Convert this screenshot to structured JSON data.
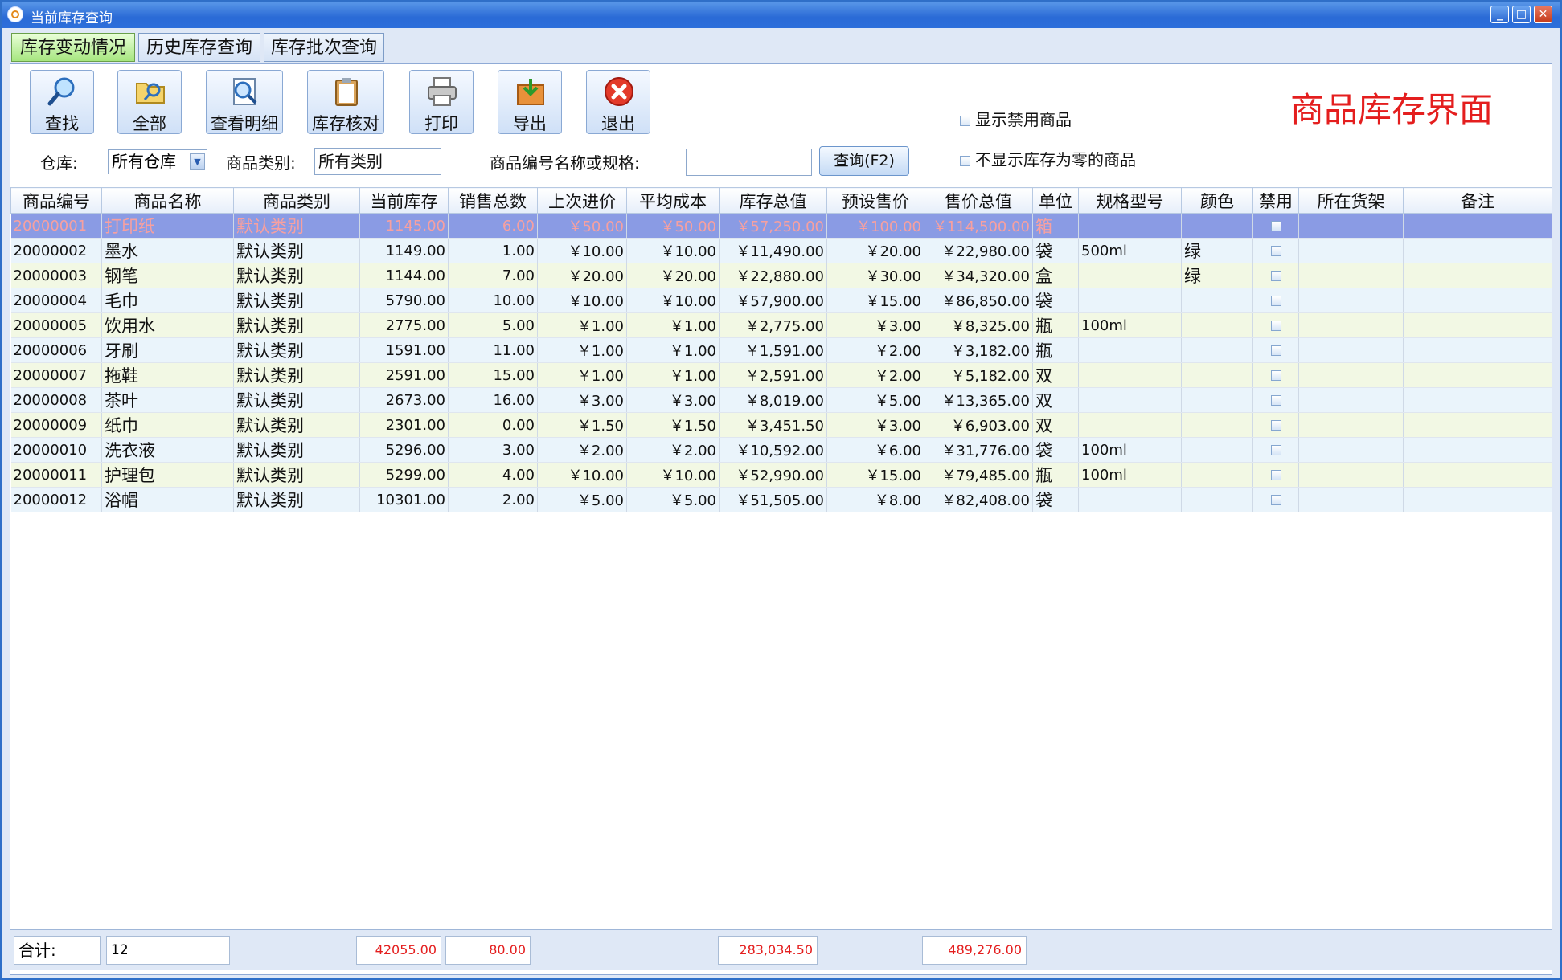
{
  "window": {
    "title": "当前库存查询",
    "min_glyph": "_",
    "max_glyph": "□",
    "close_glyph": "✕"
  },
  "tabs": [
    {
      "label": "库存变动情况",
      "active": true
    },
    {
      "label": "历史库存查询",
      "active": false
    },
    {
      "label": "库存批次查询",
      "active": false
    }
  ],
  "toolbar": {
    "buttons": [
      {
        "label": "查找",
        "icon": "magnifier-icon"
      },
      {
        "label": "全部",
        "icon": "folder-icon"
      },
      {
        "label": "查看明细",
        "icon": "document-search-icon"
      },
      {
        "label": "库存核对",
        "icon": "clipboard-icon"
      },
      {
        "label": "打印",
        "icon": "printer-icon"
      },
      {
        "label": "导出",
        "icon": "export-icon"
      },
      {
        "label": "退出",
        "icon": "close-icon"
      }
    ]
  },
  "options": {
    "show_disabled": "显示禁用商品",
    "hide_zero_stock": "不显示库存为零的商品"
  },
  "banner": "商品库存界面",
  "filters": {
    "warehouse_label": "仓库:",
    "warehouse_value": "所有仓库",
    "category_label": "商品类别:",
    "category_value": "所有类别",
    "code_label": "商品编号名称或规格:",
    "code_value": "",
    "query_button": "查询(F2)"
  },
  "table": {
    "columns": [
      "商品编号",
      "商品名称",
      "商品类别",
      "当前库存",
      "销售总数",
      "上次进价",
      "平均成本",
      "库存总值",
      "预设售价",
      "售价总值",
      "单位",
      "规格型号",
      "颜色",
      "禁用",
      "所在货架",
      "备注"
    ],
    "rows": [
      [
        "20000001",
        "打印纸",
        "默认类别",
        "1145.00",
        "6.00",
        "￥50.00",
        "￥50.00",
        "￥57,250.00",
        "￥100.00",
        "￥114,500.00",
        "箱",
        "",
        "",
        "",
        "",
        ""
      ],
      [
        "20000002",
        "墨水",
        "默认类别",
        "1149.00",
        "1.00",
        "￥10.00",
        "￥10.00",
        "￥11,490.00",
        "￥20.00",
        "￥22,980.00",
        "袋",
        "500ml",
        "绿",
        "",
        "",
        ""
      ],
      [
        "20000003",
        "钢笔",
        "默认类别",
        "1144.00",
        "7.00",
        "￥20.00",
        "￥20.00",
        "￥22,880.00",
        "￥30.00",
        "￥34,320.00",
        "盒",
        "",
        "绿",
        "",
        "",
        ""
      ],
      [
        "20000004",
        "毛巾",
        "默认类别",
        "5790.00",
        "10.00",
        "￥10.00",
        "￥10.00",
        "￥57,900.00",
        "￥15.00",
        "￥86,850.00",
        "袋",
        "",
        "",
        "",
        "",
        ""
      ],
      [
        "20000005",
        "饮用水",
        "默认类别",
        "2775.00",
        "5.00",
        "￥1.00",
        "￥1.00",
        "￥2,775.00",
        "￥3.00",
        "￥8,325.00",
        "瓶",
        "100ml",
        "",
        "",
        "",
        ""
      ],
      [
        "20000006",
        "牙刷",
        "默认类别",
        "1591.00",
        "11.00",
        "￥1.00",
        "￥1.00",
        "￥1,591.00",
        "￥2.00",
        "￥3,182.00",
        "瓶",
        "",
        "",
        "",
        "",
        ""
      ],
      [
        "20000007",
        "拖鞋",
        "默认类别",
        "2591.00",
        "15.00",
        "￥1.00",
        "￥1.00",
        "￥2,591.00",
        "￥2.00",
        "￥5,182.00",
        "双",
        "",
        "",
        "",
        "",
        ""
      ],
      [
        "20000008",
        "茶叶",
        "默认类别",
        "2673.00",
        "16.00",
        "￥3.00",
        "￥3.00",
        "￥8,019.00",
        "￥5.00",
        "￥13,365.00",
        "双",
        "",
        "",
        "",
        "",
        ""
      ],
      [
        "20000009",
        "纸巾",
        "默认类别",
        "2301.00",
        "0.00",
        "￥1.50",
        "￥1.50",
        "￥3,451.50",
        "￥3.00",
        "￥6,903.00",
        "双",
        "",
        "",
        "",
        "",
        ""
      ],
      [
        "20000010",
        "洗衣液",
        "默认类别",
        "5296.00",
        "3.00",
        "￥2.00",
        "￥2.00",
        "￥10,592.00",
        "￥6.00",
        "￥31,776.00",
        "袋",
        "100ml",
        "",
        "",
        "",
        ""
      ],
      [
        "20000011",
        "护理包",
        "默认类别",
        "5299.00",
        "4.00",
        "￥10.00",
        "￥10.00",
        "￥52,990.00",
        "￥15.00",
        "￥79,485.00",
        "瓶",
        "100ml",
        "",
        "",
        "",
        ""
      ],
      [
        "20000012",
        "浴帽",
        "默认类别",
        "10301.00",
        "2.00",
        "￥5.00",
        "￥5.00",
        "￥51,505.00",
        "￥8.00",
        "￥82,408.00",
        "袋",
        "",
        "",
        "",
        "",
        ""
      ]
    ]
  },
  "footer": {
    "label": "合计:",
    "count": "12",
    "stock_total": "42055.00",
    "sales_total": "80.00",
    "stock_value_total": "283,034.50",
    "price_value_total": "489,276.00"
  },
  "colors": {
    "title_bar": "#2a6ad6",
    "selected_row": "#8a9be4",
    "row_odd": "#f2f8e4",
    "row_even": "#eaf4fb",
    "banner_red": "#e41e1e"
  }
}
